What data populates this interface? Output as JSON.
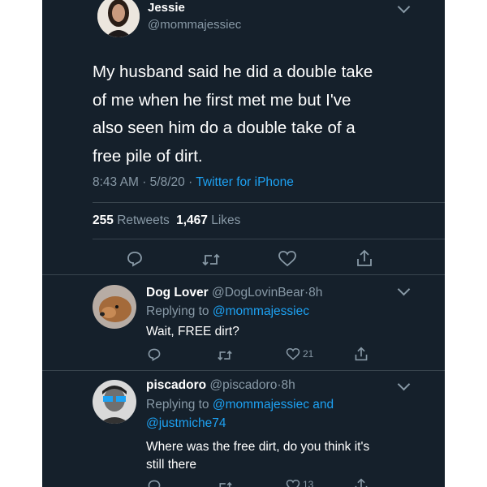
{
  "main_tweet": {
    "author_name": "Jessie",
    "author_handle": "@mommajessiec",
    "text_lines": [
      "My husband said he did a double take",
      "of me when he first met me but I've",
      "also seen him do a double take of a",
      "free pile of dirt."
    ],
    "time": "8:43 AM",
    "date": "5/8/20",
    "source": "Twitter for iPhone",
    "retweets_count": "255",
    "retweets_label": "Retweets",
    "likes_count": "1,467",
    "likes_label": "Likes",
    "sep": "·"
  },
  "replies": [
    {
      "name": "Dog Lover",
      "handle": "@DogLovinBear",
      "time": "8h",
      "replying_prefix": "Replying to",
      "replying_to_line1": "@mommajessiec",
      "text_lines": [
        "Wait, FREE dirt?"
      ],
      "likes": "21"
    },
    {
      "name": "piscadoro",
      "handle": "@piscadoro",
      "time": "8h",
      "replying_prefix": "Replying to",
      "replying_to_line1": "@mommajessiec and",
      "replying_to_line2": "@justmiche74",
      "text_lines": [
        "Where was the free dirt, do you think it's",
        "still there"
      ],
      "likes": "13"
    }
  ],
  "icons": [
    "reply-icon",
    "retweet-icon",
    "like-icon",
    "share-icon",
    "chevron-down-icon"
  ],
  "colors": {
    "background": "#15202b",
    "text": "#ffffff",
    "muted": "#8899a6",
    "link": "#1da1f2",
    "divider": "#38444d"
  }
}
